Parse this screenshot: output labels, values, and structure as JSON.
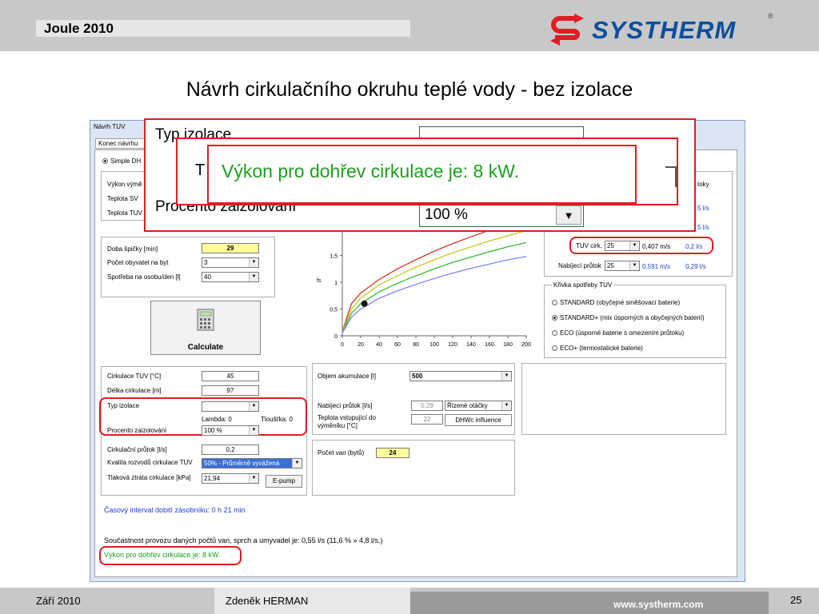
{
  "header": {
    "title": "Joule 2010",
    "logo_text": "SYSTHERM",
    "logo_reg": "®"
  },
  "slide_title": "Návrh cirkulačního okruhu teplé vody - bez izolace",
  "footer": {
    "date": "Září 2010",
    "author": "Zdeněk HERMAN",
    "url": "www.systherm.com",
    "page": "25"
  },
  "window": {
    "title": "Návrh TUV",
    "tab": "Konec návrhu",
    "mode_radio": "Simple DH"
  },
  "top_left": {
    "vykon_label": "Výkon výmě",
    "teplota_sv": "Teplota SV",
    "teplota_tuv": "Teplota TUV"
  },
  "right_top": {
    "header_tail": "toky",
    "v1": "5 l/s",
    "v2": "5 l/s",
    "tuv_cirk_label": "TUV cirk.",
    "tuv_cirk_val": "25",
    "tuv_cirk_speed": "0,407 m/s",
    "tuv_cirk_flow": "0,2 l/s",
    "nabijeci_label": "Nabíjecí průtok",
    "nabijeci_val": "25",
    "nabijeci_speed": "0,591 m/s",
    "nabijeci_flow": "0,29 l/s"
  },
  "peak": {
    "doba_label": "Doba špičky [min]",
    "doba_val": "29",
    "pocet_label": "Počet obyvatel na byt",
    "pocet_val": "3",
    "spotreba_label": "Spotřeba na osobu/den [l]",
    "spotreba_val": "40"
  },
  "calc": {
    "label": "Calculate"
  },
  "curve": {
    "legend": "Křivka spotřeby TUV",
    "options": [
      "STANDARD (obyčejné směšovací baterie)",
      "STANDARD+ (mix úsporných a obyčejných baterií)",
      "ECO (úsporné baterie s omezením průtoku)",
      "ECO+ (termostatické baterie)"
    ],
    "selected": 1
  },
  "circ": {
    "cirk_label": "Cirkulace TUV [°C]",
    "cirk_val": "45",
    "delka_label": "Délka cirkulace  [m]",
    "delka_val": "97",
    "typ_label": "Typ izolace",
    "lambda": "Lambda: 0",
    "tloustka": "Tloušťka: 0",
    "procento_label": "Procento zaizolování",
    "procento_val": "100 %",
    "prutok_label": "Cirkulační průtok [l/s]",
    "prutok_val": "0,2",
    "kvalita_label": "Kvalita rozvodů cirkulace TUV",
    "kvalita_val": "50% - Průměrně vyvážená",
    "ztrata_label": "Tlaková ztráta cirkulace [kPa]",
    "ztrata_val": "21,94",
    "epump": "E-pump"
  },
  "acc": {
    "objem_label": "Objem akumulace [l]",
    "objem_val": "500",
    "nab_label": "Nabíjecí průtok [l/s]",
    "nab_val": "0,29",
    "nab_mode": "Řízené otáčky",
    "tepl_label1": "Teplota vstupující do",
    "tepl_label2": "výměníku [°C]",
    "tepl_val": "22",
    "dhwc": "DHWc influence",
    "van_label": "Počet van (bytů)",
    "van_val": "24"
  },
  "status": {
    "interval": "Časový interval dobití zásobníku: 0 h 21 min",
    "soucasnost": "Součastnost provozu daných počtů van, sprch a umyvadel je:  0,55 l/s (11,6 % » 4,8 l/s.)",
    "vykon": "Výkon pro dohřev cirkulace je:  8 kW."
  },
  "overlay": {
    "typ_izolace": "Typ izolace",
    "t_letter": "T",
    "procento": "Procento zaizolování",
    "select_val": "100 %",
    "vykon": "Výkon pro dohřev cirkulace je:  8 kW."
  },
  "chart_data": {
    "type": "line",
    "xlim": [
      0,
      200
    ],
    "ylim": [
      0,
      2
    ],
    "xticks": [
      "0",
      "20",
      "40",
      "60",
      "80",
      "100",
      "120",
      "140",
      "160",
      "180",
      "200"
    ],
    "yticks": [
      "0",
      "0,5",
      "1",
      "1,5",
      "2"
    ],
    "ylabel": "fs",
    "series": [
      {
        "color": "#e03030",
        "x": [
          0,
          10,
          20,
          40,
          60,
          80,
          100,
          120,
          140,
          160,
          180,
          200
        ],
        "y": [
          0.08,
          0.6,
          0.8,
          1.05,
          1.25,
          1.42,
          1.58,
          1.72,
          1.85,
          1.97,
          2.08,
          2.2
        ]
      },
      {
        "color": "#c8c820",
        "x": [
          0,
          10,
          20,
          40,
          60,
          80,
          100,
          120,
          140,
          160,
          180,
          200
        ],
        "y": [
          0.07,
          0.5,
          0.7,
          0.95,
          1.12,
          1.28,
          1.42,
          1.55,
          1.66,
          1.77,
          1.87,
          1.96
        ]
      },
      {
        "color": "#30c030",
        "x": [
          0,
          10,
          20,
          40,
          60,
          80,
          100,
          120,
          140,
          160,
          180,
          200
        ],
        "y": [
          0.06,
          0.42,
          0.6,
          0.82,
          0.98,
          1.12,
          1.25,
          1.37,
          1.47,
          1.57,
          1.66,
          1.74
        ]
      },
      {
        "color": "#8080ff",
        "x": [
          0,
          10,
          20,
          40,
          60,
          80,
          100,
          120,
          140,
          160,
          180,
          200
        ],
        "y": [
          0.05,
          0.35,
          0.5,
          0.7,
          0.84,
          0.96,
          1.07,
          1.17,
          1.26,
          1.34,
          1.42,
          1.48
        ]
      }
    ],
    "marker": {
      "x": 24,
      "y": 0.6
    }
  },
  "colors": {
    "accent_red": "#e31b23",
    "status_blue": "#1c3fd6",
    "status_green": "#1ca01c",
    "yellow_field": "#ffff99"
  }
}
